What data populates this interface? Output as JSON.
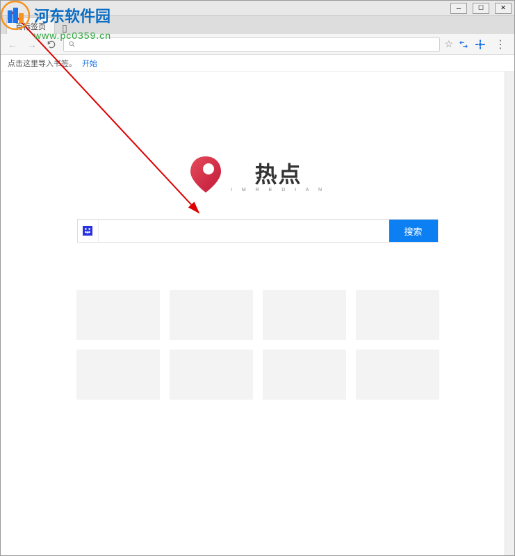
{
  "window": {
    "minimize": "─",
    "maximize": "☐",
    "close": "✕"
  },
  "tabs": {
    "active": "百标签页"
  },
  "nav": {
    "back": "←",
    "forward": "→",
    "reload": "⟳"
  },
  "addressbar": {
    "search_icon": "🔍",
    "value": "",
    "star": "☆"
  },
  "bookmarks": {
    "hint": "点击这里导入书签。",
    "start": "开始"
  },
  "logo": {
    "text": "热点",
    "sub": "I M R E D I A N"
  },
  "search": {
    "placeholder": "",
    "button": "搜索"
  },
  "watermark": {
    "site": "河东软件园",
    "url": "www.pc0359.cn"
  },
  "colors": {
    "search_button": "#0c7ff2",
    "logo_red": "#d6203a",
    "wm_blue": "#0b6dc4",
    "wm_green": "#2fa83d",
    "wm_orange": "#f7931e"
  }
}
